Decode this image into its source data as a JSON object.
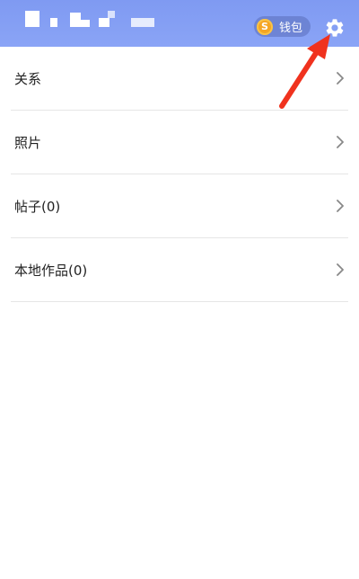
{
  "header": {
    "wallet_label": "钱包",
    "wallet_coin_glyph": "S",
    "settings_icon": "gear-icon",
    "gradient_colors": [
      "#7f9af2",
      "#8aa4f6"
    ]
  },
  "menu": {
    "items": [
      {
        "label": "关系",
        "icon": "chevron-right-icon"
      },
      {
        "label": "照片",
        "icon": "chevron-right-icon"
      },
      {
        "label": "帖子(0)",
        "icon": "chevron-right-icon"
      },
      {
        "label": "本地作品(0)",
        "icon": "chevron-right-icon"
      }
    ]
  },
  "annotation": {
    "arrow_color": "#f0321e"
  }
}
